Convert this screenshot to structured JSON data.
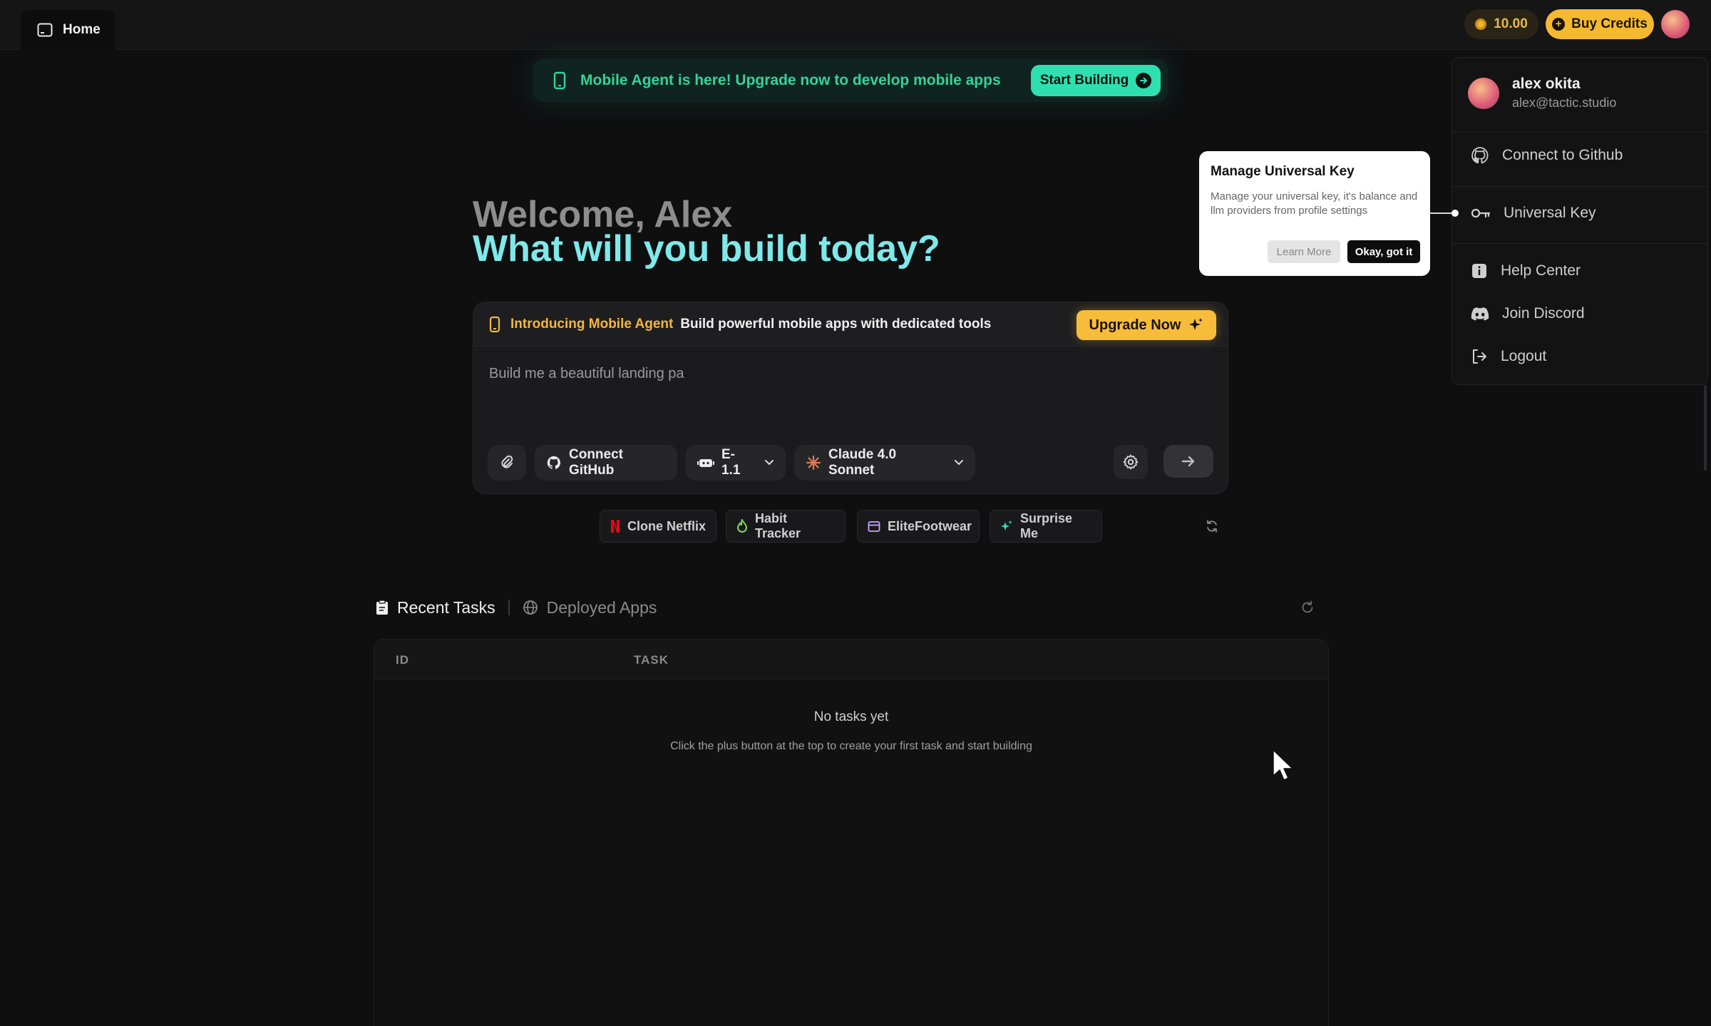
{
  "topbar": {
    "home_label": "Home",
    "credits": "10.00",
    "buy_credits_label": "Buy Credits"
  },
  "banner": {
    "text": "Mobile Agent is here! Upgrade now to develop mobile apps",
    "cta": "Start Building"
  },
  "hero": {
    "welcome": "Welcome, Alex",
    "question": "What will you build today?"
  },
  "composer": {
    "intro_label": "Introducing Mobile Agent",
    "intro_desc": "Build powerful mobile apps with dedicated tools",
    "upgrade_label": "Upgrade Now",
    "input_value": "Build me a beautiful landing pa",
    "connect_github": "Connect GitHub",
    "agent": "E-1.1",
    "model": "Claude 4.0 Sonnet"
  },
  "suggestions": [
    {
      "label": "Clone Netflix",
      "icon": "netflix-icon"
    },
    {
      "label": "Habit Tracker",
      "icon": "flame-icon"
    },
    {
      "label": "EliteFootwear",
      "icon": "calendar-icon"
    },
    {
      "label": "Surprise Me",
      "icon": "sparkle-icon"
    }
  ],
  "tabs": {
    "recent": "Recent Tasks",
    "deployed": "Deployed Apps"
  },
  "table": {
    "columns": [
      "ID",
      "TASK"
    ],
    "empty_title": "No tasks yet",
    "empty_desc": "Click the plus button at the top to create your first task and start building"
  },
  "tooltip": {
    "title": "Manage Universal Key",
    "body": "Manage your universal key, it's balance and llm providers from profile settings",
    "learn_more": "Learn More",
    "ok": "Okay, got it"
  },
  "profile_menu": {
    "name": "alex okita",
    "email": "alex@tactic.studio",
    "items": [
      {
        "label": "Connect to Github",
        "icon": "github-icon"
      },
      {
        "label": "Universal Key",
        "icon": "key-icon"
      },
      {
        "label": "Help Center",
        "icon": "info-icon"
      },
      {
        "label": "Join Discord",
        "icon": "discord-icon"
      },
      {
        "label": "Logout",
        "icon": "logout-icon"
      }
    ]
  },
  "colors": {
    "accent_teal": "#2ee0b0",
    "accent_gold": "#f5b930",
    "hero_cyan": "#7fe9e9"
  }
}
